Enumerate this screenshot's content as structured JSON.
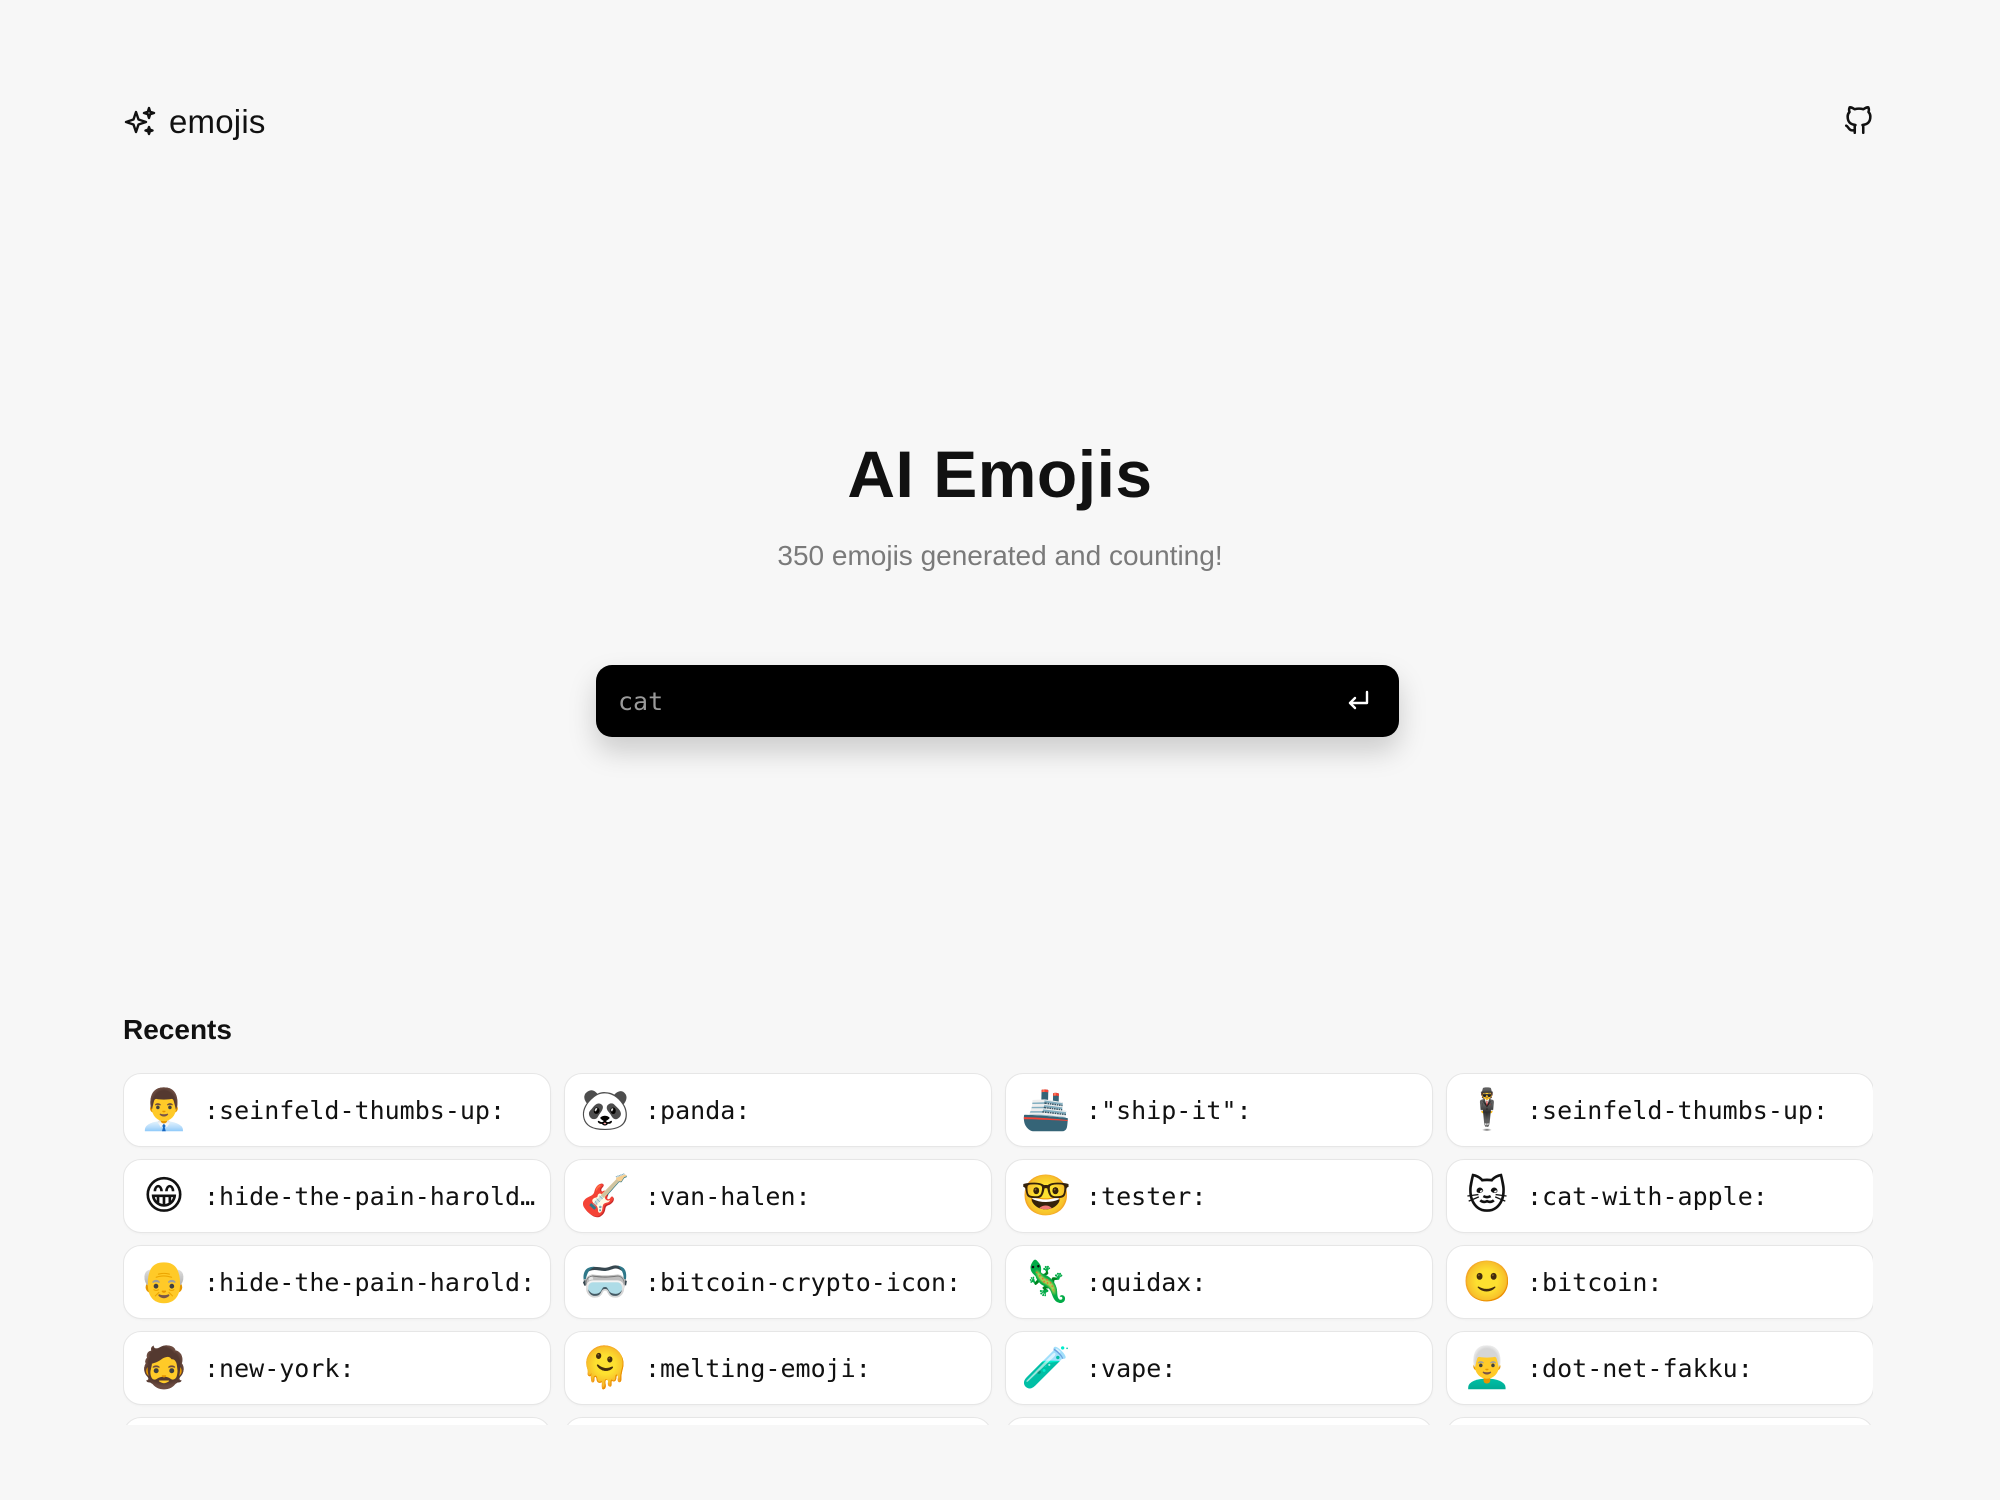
{
  "header": {
    "brand": "emojis",
    "brand_icon": "sparkles-icon",
    "github_icon": "github-icon"
  },
  "hero": {
    "title": "AI Emojis",
    "subtitle": "350 emojis generated and counting!"
  },
  "search": {
    "value": "cat",
    "submit_icon": "enter-return-icon"
  },
  "recents": {
    "title": "Recents",
    "items": [
      {
        "emoji": "👨‍💼",
        "label": ":seinfeld-thumbs-up:"
      },
      {
        "emoji": "🐼",
        "label": ":panda:"
      },
      {
        "emoji": "🚢",
        "label": ":\"ship-it\":"
      },
      {
        "emoji": "🕴",
        "label": ":seinfeld-thumbs-up:"
      },
      {
        "emoji": "😁",
        "label": ":hide-the-pain-harold…"
      },
      {
        "emoji": "🎸",
        "label": ":van-halen:"
      },
      {
        "emoji": "🤓",
        "label": ":tester:"
      },
      {
        "emoji": "🐱",
        "label": ":cat-with-apple:"
      },
      {
        "emoji": "👴",
        "label": ":hide-the-pain-harold:"
      },
      {
        "emoji": "🥽",
        "label": ":bitcoin-crypto-icon:"
      },
      {
        "emoji": "🦎",
        "label": ":quidax:"
      },
      {
        "emoji": "🙂",
        "label": ":bitcoin:"
      },
      {
        "emoji": "🧔",
        "label": ":new-york:"
      },
      {
        "emoji": "🫠",
        "label": ":melting-emoji:"
      },
      {
        "emoji": "🧪",
        "label": ":vape:"
      },
      {
        "emoji": "👨‍🦳",
        "label": ":dot-net-fakku:"
      },
      {
        "emoji": "",
        "label": ""
      },
      {
        "emoji": "",
        "label": ""
      },
      {
        "emoji": "",
        "label": ""
      },
      {
        "emoji": "",
        "label": ""
      }
    ]
  }
}
